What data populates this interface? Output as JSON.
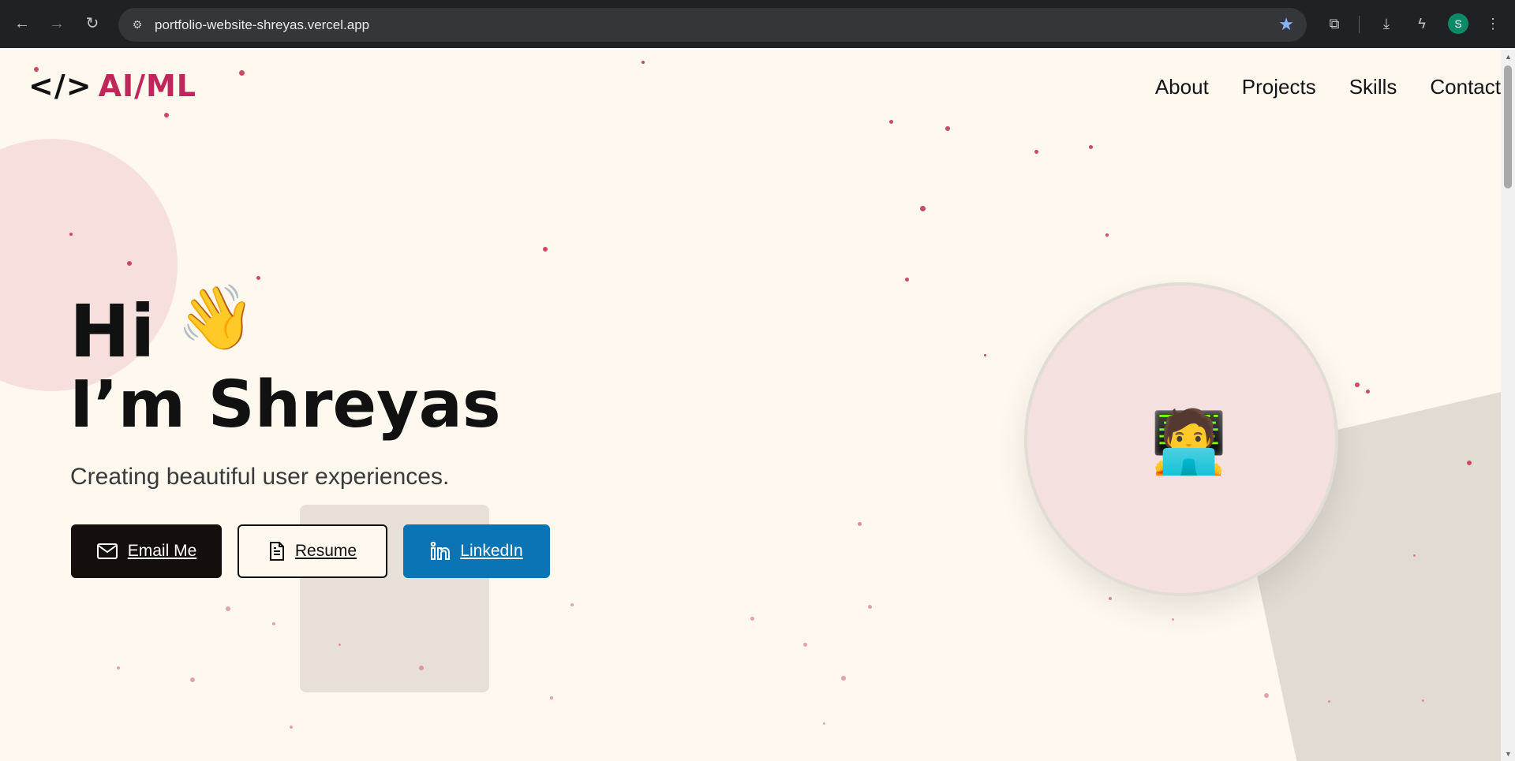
{
  "browser": {
    "url": "portfolio-website-shreyas.vercel.app",
    "profile_initial": "S",
    "back_icon": "arrow-left-icon",
    "forward_icon": "arrow-right-icon",
    "reload_icon": "reload-icon",
    "bookmark_icon": "star-icon"
  },
  "header": {
    "logo_code": "</>",
    "logo_text": "AI/ML",
    "nav": [
      "About",
      "Projects",
      "Skills",
      "Contact"
    ]
  },
  "hero": {
    "greeting": "Hi",
    "wave_emoji": "👋",
    "name": "I’m Shreyas",
    "tagline": "Creating beautiful user experiences.",
    "buttons": {
      "email": "Email Me",
      "resume": "Resume",
      "linkedin": "LinkedIn"
    },
    "avatar_emoji": "🧑‍💻"
  },
  "colors": {
    "accent": "#c0265a",
    "background": "#fff8ee",
    "linkedin": "#0a74b5",
    "dark_button": "#140f0c"
  }
}
